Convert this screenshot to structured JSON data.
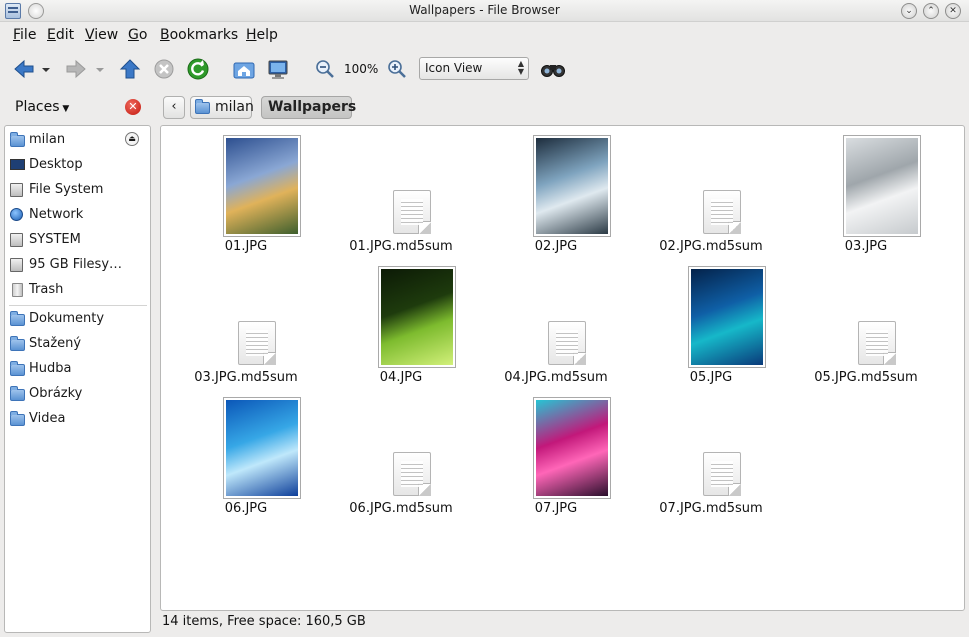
{
  "window": {
    "title": "Wallpapers - File Browser"
  },
  "menu": [
    {
      "label": "File",
      "mnemonic": "F",
      "rest": "ile"
    },
    {
      "label": "Edit",
      "mnemonic": "E",
      "rest": "dit"
    },
    {
      "label": "View",
      "mnemonic": "V",
      "rest": "iew"
    },
    {
      "label": "Go",
      "mnemonic": "G",
      "rest": "o"
    },
    {
      "label": "Bookmarks",
      "mnemonic": "B",
      "rest": "ookmarks"
    },
    {
      "label": "Help",
      "mnemonic": "H",
      "rest": "elp"
    }
  ],
  "toolbar": {
    "zoom_level": "100%",
    "view_mode": "Icon View",
    "icons": [
      "back-icon",
      "back-history-icon",
      "forward-icon",
      "forward-history-icon",
      "up-icon",
      "stop-icon",
      "reload-icon",
      "home-icon",
      "computer-icon",
      "zoom-out-icon",
      "zoom-in-icon",
      "find-icon"
    ]
  },
  "places": {
    "title": "Places",
    "items": [
      {
        "label": "milan",
        "icon": "home-folder-icon"
      },
      {
        "label": "Desktop",
        "icon": "desktop-icon"
      },
      {
        "label": "File System",
        "icon": "drive-icon"
      },
      {
        "label": "Network",
        "icon": "network-icon"
      },
      {
        "label": "SYSTEM",
        "icon": "drive-icon"
      },
      {
        "label": "95 GB Filesy…",
        "icon": "drive-icon"
      },
      {
        "label": "Trash",
        "icon": "trash-icon"
      },
      {
        "label": "Dokumenty",
        "icon": "folder-icon"
      },
      {
        "label": "Stažený",
        "icon": "folder-icon"
      },
      {
        "label": "Hudba",
        "icon": "folder-icon"
      },
      {
        "label": "Obrázky",
        "icon": "folder-icon"
      },
      {
        "label": "Videa",
        "icon": "folder-icon"
      }
    ]
  },
  "breadcrumb": {
    "parent": "milan",
    "current": "Wallpapers"
  },
  "files": [
    {
      "name": "01.JPG",
      "type": "image",
      "colors": [
        "#2d4f8f",
        "#8aa7d4",
        "#e0b25a",
        "#3e5f2d"
      ]
    },
    {
      "name": "01.JPG.md5sum",
      "type": "text"
    },
    {
      "name": "02.JPG",
      "type": "image",
      "colors": [
        "#1d2d3d",
        "#7fa4bf",
        "#dfe9ef",
        "#2b3a45"
      ]
    },
    {
      "name": "02.JPG.md5sum",
      "type": "text"
    },
    {
      "name": "03.JPG",
      "type": "image",
      "colors": [
        "#d9dde0",
        "#9fa6ab",
        "#f2f3f4",
        "#c6cacd"
      ]
    },
    {
      "name": "03.JPG.md5sum",
      "type": "text"
    },
    {
      "name": "04.JPG",
      "type": "image",
      "colors": [
        "#0c1a06",
        "#1e3b0d",
        "#7dbb2e",
        "#d2f07a"
      ]
    },
    {
      "name": "04.JPG.md5sum",
      "type": "text"
    },
    {
      "name": "05.JPG",
      "type": "image",
      "colors": [
        "#04224a",
        "#0f5fa6",
        "#16b8c9",
        "#0a3a7a"
      ]
    },
    {
      "name": "05.JPG.md5sum",
      "type": "text"
    },
    {
      "name": "06.JPG",
      "type": "image",
      "colors": [
        "#0b57b8",
        "#36a7e6",
        "#bfe8fb",
        "#0e3f9a"
      ]
    },
    {
      "name": "06.JPG.md5sum",
      "type": "text"
    },
    {
      "name": "07.JPG",
      "type": "image",
      "colors": [
        "#26c5d4",
        "#c2187a",
        "#ff66b8",
        "#2a0f2c"
      ]
    },
    {
      "name": "07.JPG.md5sum",
      "type": "text"
    }
  ],
  "status": "14 items, Free space: 160,5 GB"
}
